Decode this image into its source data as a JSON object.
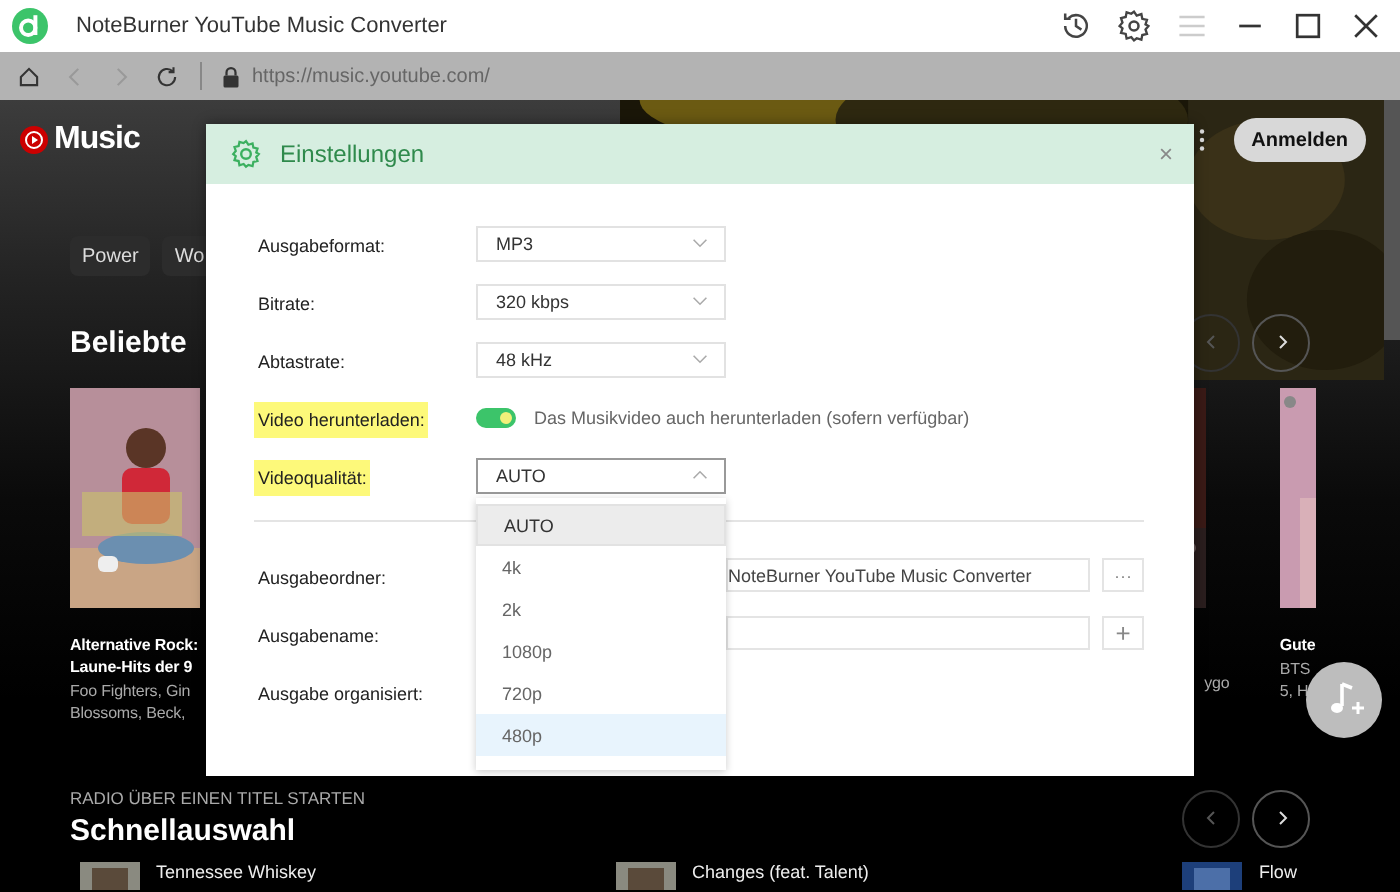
{
  "window": {
    "title": "NoteBurner YouTube Music Converter",
    "tools": [
      {
        "kind": "history",
        "disabled": false
      },
      {
        "kind": "settings",
        "disabled": false
      },
      {
        "kind": "menu",
        "disabled": true
      }
    ]
  },
  "browser": {
    "nav": [
      {
        "kind": "home",
        "disabled": false
      },
      {
        "kind": "back",
        "disabled": true
      },
      {
        "kind": "forward",
        "disabled": true
      },
      {
        "kind": "reload",
        "disabled": false
      }
    ],
    "url": "https://music.youtube.com/"
  },
  "page": {
    "logo": "Music",
    "sign_in": "Anmelden",
    "chips": [
      "Power",
      "Wo"
    ],
    "section_title": "Beliebte",
    "cards": [
      {
        "kind": "left",
        "title": "Alternative Rock:\nLaune-Hits der 9",
        "subtitle": "Foo Fighters, Gin\nBlossoms, Beck,"
      },
      {
        "kind": "middle",
        "subtitle": "ygo"
      },
      {
        "kind": "right",
        "title": "Gute",
        "subtitle": "BTS\n5, H"
      }
    ],
    "radio_caption": "RADIO ÜBER EINEN TITEL STARTEN",
    "quick_title": "Schnellauswahl",
    "quick_items": [
      "Tennessee Whiskey",
      "Changes (feat. Talent)",
      "Flow"
    ]
  },
  "dialog": {
    "title": "Einstellungen",
    "settings": [
      {
        "kind": "select",
        "label": "Ausgabeformat:",
        "value": "MP3",
        "highlighted": false,
        "open": false
      },
      {
        "kind": "select",
        "label": "Bitrate:",
        "value": "320 kbps",
        "highlighted": false,
        "open": false
      },
      {
        "kind": "select",
        "label": "Abtastrate:",
        "value": "48 kHz",
        "highlighted": false,
        "open": false
      },
      {
        "kind": "toggle",
        "label": "Video herunterladen:",
        "on": true,
        "description": "Das Musikvideo auch herunterladen (sofern verfügbar)",
        "highlighted": true
      },
      {
        "kind": "select",
        "label": "Videoqualität:",
        "value": "AUTO",
        "highlighted": true,
        "open": true
      }
    ],
    "options": [
      {
        "label": "AUTO",
        "selected": true,
        "hovered": false
      },
      {
        "label": "4k",
        "selected": false,
        "hovered": false
      },
      {
        "label": "2k",
        "selected": false,
        "hovered": false
      },
      {
        "label": "1080p",
        "selected": false,
        "hovered": false
      },
      {
        "label": "720p",
        "selected": false,
        "hovered": false
      },
      {
        "label": "480p",
        "selected": false,
        "hovered": true
      }
    ],
    "output": [
      {
        "kind": "folder",
        "label": "Ausgabeordner:",
        "value": "NoteBurner YouTube Music Converter",
        "button": "···"
      },
      {
        "kind": "name",
        "label": "Ausgabename:",
        "button": "+"
      },
      {
        "kind": "plain",
        "label": "Ausgabe organisiert:"
      }
    ]
  }
}
